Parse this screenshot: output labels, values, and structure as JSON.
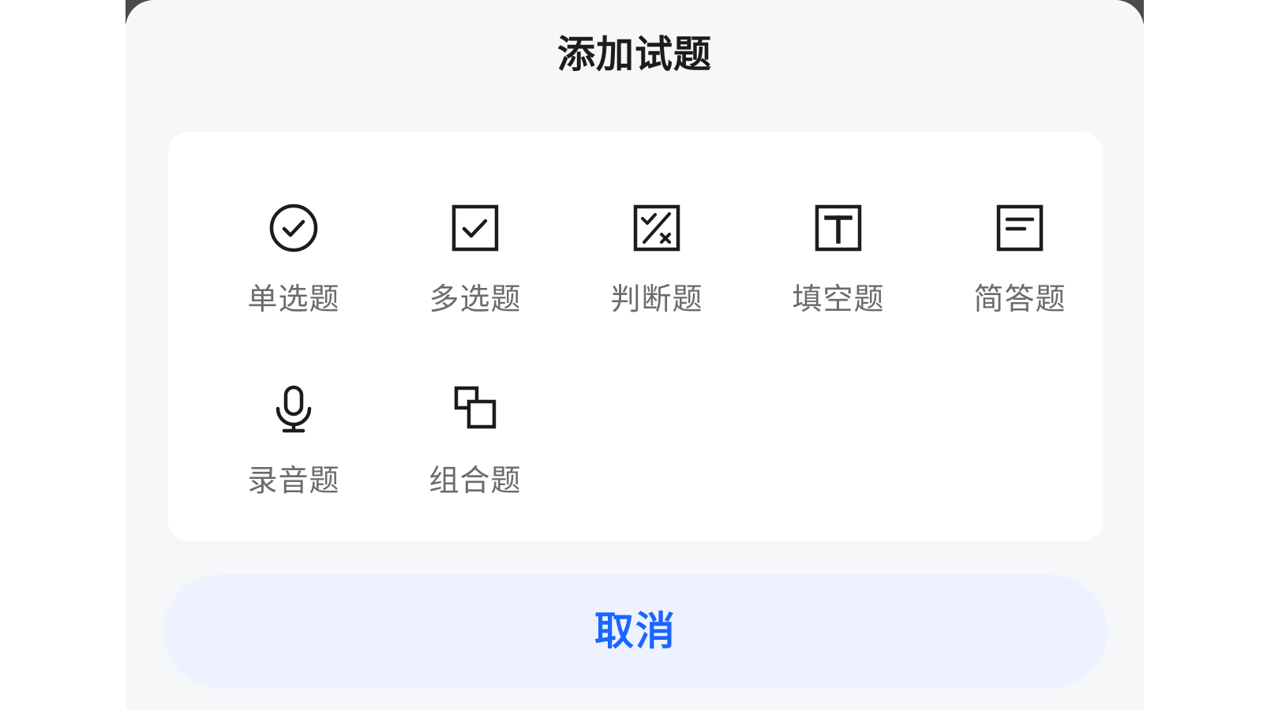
{
  "sheet": {
    "title": "添加试题"
  },
  "question_types": [
    {
      "label": "单选题",
      "icon": "radio-check-icon"
    },
    {
      "label": "多选题",
      "icon": "checkbox-icon"
    },
    {
      "label": "判断题",
      "icon": "true-false-icon"
    },
    {
      "label": "填空题",
      "icon": "text-box-icon"
    },
    {
      "label": "简答题",
      "icon": "short-answer-icon"
    },
    {
      "label": "录音题",
      "icon": "microphone-icon"
    },
    {
      "label": "组合题",
      "icon": "combine-icon"
    }
  ],
  "footer": {
    "cancel_label": "取消"
  },
  "colors": {
    "accent": "#1a66ff",
    "cancel_bg": "#edf2fe",
    "sheet_bg": "#f6f7f9",
    "label": "#6b6b6b"
  }
}
